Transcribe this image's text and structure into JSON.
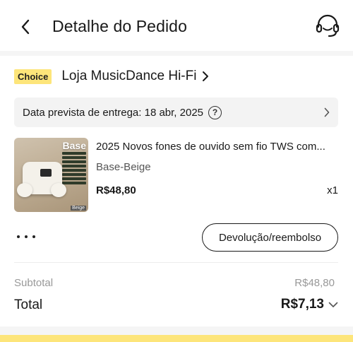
{
  "header": {
    "title": "Detalhe do Pedido",
    "back_icon": "chevron-left-icon",
    "support_icon": "headset-icon"
  },
  "store": {
    "badge": "Choice",
    "name": "Loja MusicDance Hi-Fi",
    "badge_color": "#fde57a"
  },
  "delivery": {
    "text": "Data prevista de entrega: 18 abr, 2025",
    "info_symbol": "?"
  },
  "product": {
    "image_label": "Base",
    "image_tag": "Beige",
    "title": "2025 Novos fones de ouvido sem fio TWS com...",
    "variant": "Base-Beige",
    "price": "R$48,80",
    "quantity": "x1"
  },
  "actions": {
    "refund_label": "Devolução/reembolso"
  },
  "summary": {
    "subtotal_label": "Subtotal",
    "subtotal_value": "R$48,80",
    "total_label": "Total",
    "total_value": "R$7,13"
  }
}
